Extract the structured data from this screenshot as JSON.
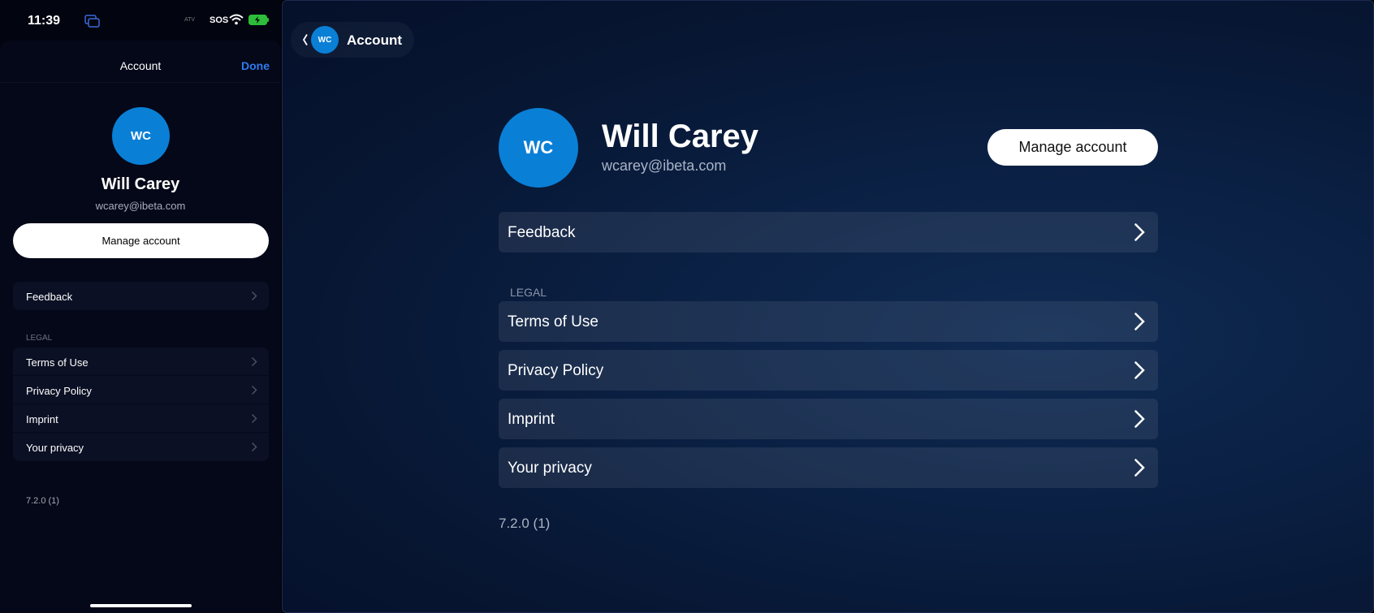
{
  "phone": {
    "status": {
      "time": "11:39",
      "app_icon": "copy-windows-icon",
      "mini_text": "ATV",
      "sos": "SOS",
      "wifi_icon": "wifi-icon",
      "battery_icon": "battery-charging-icon"
    },
    "header": {
      "title": "Account",
      "done_label": "Done"
    },
    "profile": {
      "initials": "WC",
      "name": "Will Carey",
      "email": "wcarey@ibeta.com"
    },
    "manage_label": "Manage account",
    "feedback_label": "Feedback",
    "legal_header": "LEGAL",
    "legal_items": [
      {
        "label": "Terms of Use"
      },
      {
        "label": "Privacy Policy"
      },
      {
        "label": "Imprint"
      },
      {
        "label": "Your privacy"
      }
    ],
    "version": "7.2.0 (1)"
  },
  "tablet": {
    "nav": {
      "initials": "WC",
      "title": "Account",
      "back_icon": "chevron-left-icon"
    },
    "profile": {
      "initials": "WC",
      "name": "Will Carey",
      "email": "wcarey@ibeta.com"
    },
    "manage_label": "Manage account",
    "feedback_label": "Feedback",
    "legal_header": "LEGAL",
    "legal_items": [
      {
        "label": "Terms of Use"
      },
      {
        "label": "Privacy Policy"
      },
      {
        "label": "Imprint"
      },
      {
        "label": "Your privacy"
      }
    ],
    "version": "7.2.0 (1)"
  },
  "colors": {
    "accent_blue": "#2e7bf0",
    "avatar_blue": "#0a7fd6",
    "phone_bg": "#02040f",
    "tablet_bg": "#0a1f42"
  }
}
